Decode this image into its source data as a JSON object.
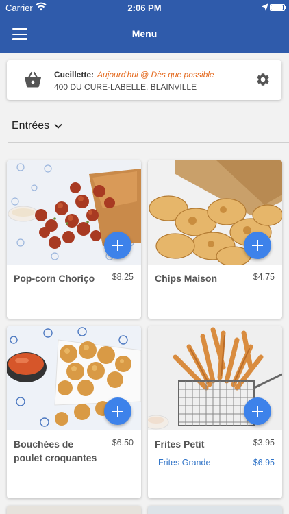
{
  "status_bar": {
    "carrier": "Carrier",
    "time": "2:06 PM"
  },
  "header": {
    "title": "Menu",
    "menu_icon": "hamburger-icon"
  },
  "pickup": {
    "label": "Cueillette:",
    "when": "Aujourd'hui @ Dès que possible",
    "address": "400 DU CURE-LABELLE, BLAINVILLE",
    "icon": "basket-icon",
    "settings_icon": "gear-icon"
  },
  "category": {
    "selected": "Entrées"
  },
  "colors": {
    "primary": "#2f5bab",
    "accent": "#3d82ea",
    "highlight": "#e46b20",
    "link": "#2f73c7"
  },
  "items": [
    {
      "name": "Pop-corn Choriço",
      "price": "$8.25"
    },
    {
      "name": "Chips Maison",
      "price": "$4.75"
    },
    {
      "name": "Bouchées de poulet croquantes",
      "price": "$6.50"
    },
    {
      "name": "Frites Petit",
      "price": "$3.95",
      "variant": {
        "name": "Frites Grande",
        "price": "$6.95"
      }
    }
  ]
}
